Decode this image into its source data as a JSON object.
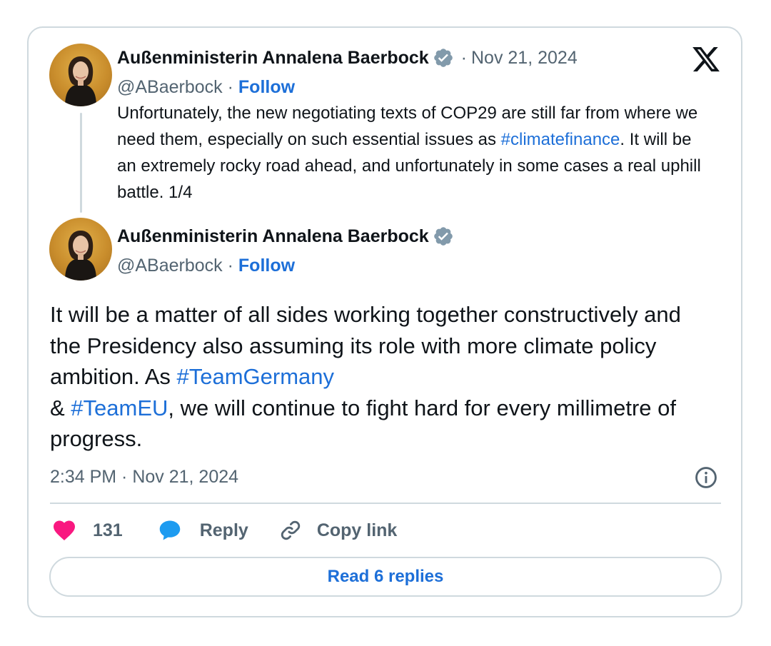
{
  "colors": {
    "link": "#1d6fd8",
    "text": "#0f1419",
    "muted": "#536471",
    "border": "#cfd9de",
    "heart": "#f91880",
    "reply_bubble": "#1d9bf0",
    "verified_badge": "#829aab"
  },
  "icons": {
    "brand": "x-logo-icon",
    "verified": "verified-badge-icon",
    "info": "info-icon",
    "like": "heart-icon",
    "reply": "speech-bubble-icon",
    "copy": "link-icon"
  },
  "quoted_tweet": {
    "display_name": "Außenministerin Annalena Baerbock",
    "separator": "·",
    "date": "Nov 21, 2024",
    "handle": "@ABaerbock",
    "handle_separator": "·",
    "follow_label": "Follow",
    "text_part1": "Unfortunately, the new negotiating texts of COP29 are still far from where we need them, especially on such essential issues as ",
    "hashtag": "#climatefinance",
    "text_part2": ". It will be an extremely rocky road ahead, and unfortunately in some cases a real uphill battle. 1/4"
  },
  "main_tweet": {
    "display_name": "Außenministerin Annalena Baerbock",
    "handle": "@ABaerbock",
    "handle_separator": "·",
    "follow_label": "Follow",
    "text_part1": "It will be a matter of all sides working together constructively and the Presidency also assuming its role with more climate policy ambition. As ",
    "hashtag1": "#TeamGermany",
    "text_part2": " & ",
    "hashtag2": "#TeamEU",
    "text_part3": ", we will continue to fight hard for every millimetre of progress.",
    "timestamp": "2:34 PM · Nov 21, 2024"
  },
  "actions": {
    "like_count": "131",
    "reply_label": "Reply",
    "copy_label": "Copy link"
  },
  "read_replies_label": "Read 6 replies"
}
